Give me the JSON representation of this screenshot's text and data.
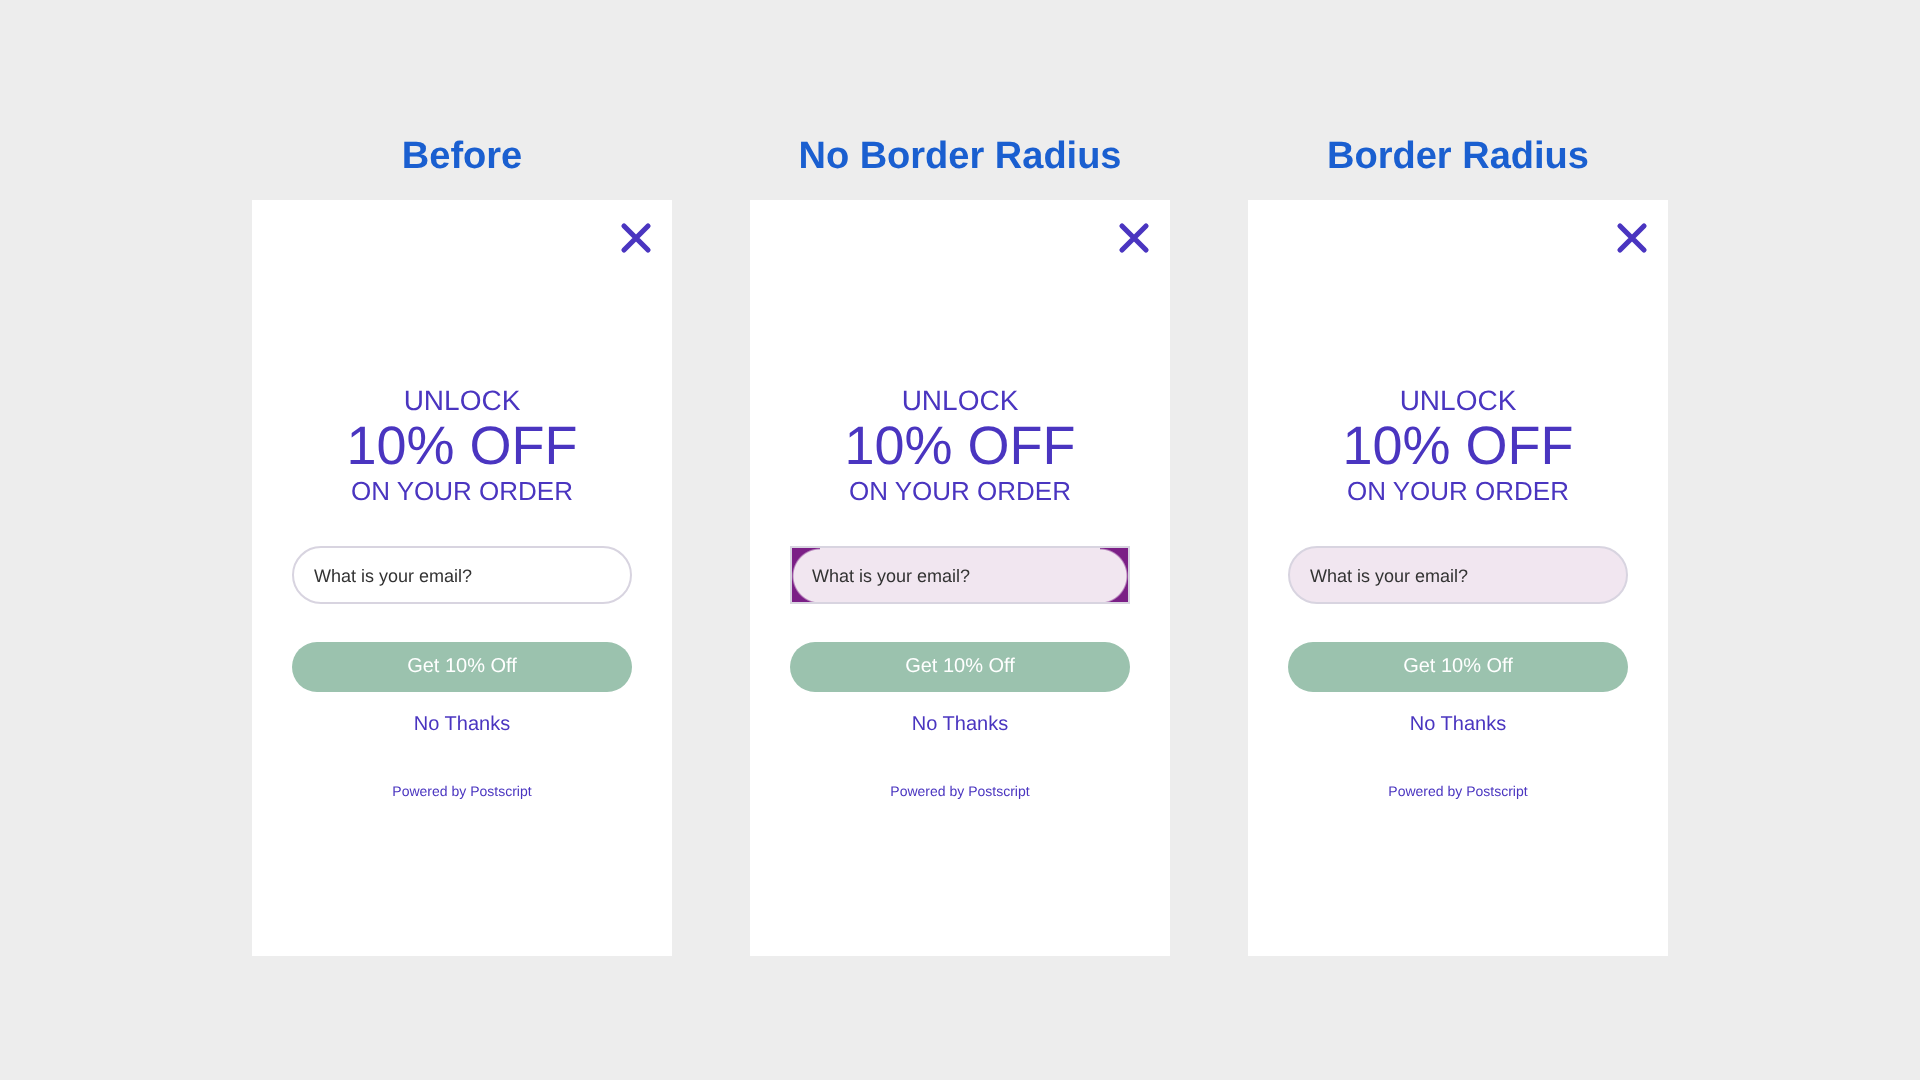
{
  "panels": [
    {
      "title": "Before",
      "popup": {
        "line_1": "UNLOCK",
        "headline": "10% OFF",
        "line_2": "ON YOUR ORDER",
        "email_field": {
          "placeholder": "What is your email?",
          "kind": "plain"
        },
        "submit_button": "Get 10% Off",
        "decline_link": "No Thanks",
        "footer": "Powered by Postscript"
      }
    },
    {
      "title": "No Border Radius",
      "popup": {
        "line_1": "UNLOCK",
        "headline": "10% OFF",
        "line_2": "ON YOUR ORDER",
        "email_field": {
          "placeholder": "What is your email?",
          "kind": "square"
        },
        "submit_button": "Get 10% Off",
        "decline_link": "No Thanks",
        "footer": "Powered by Postscript"
      }
    },
    {
      "title": "Border Radius",
      "popup": {
        "line_1": "UNLOCK",
        "headline": "10% OFF",
        "line_2": "ON YOUR ORDER",
        "email_field": {
          "placeholder": "What is your email?",
          "kind": "rounded"
        },
        "submit_button": "Get 10% Off",
        "decline_link": "No Thanks",
        "footer": "Powered by Postscript"
      }
    }
  ]
}
